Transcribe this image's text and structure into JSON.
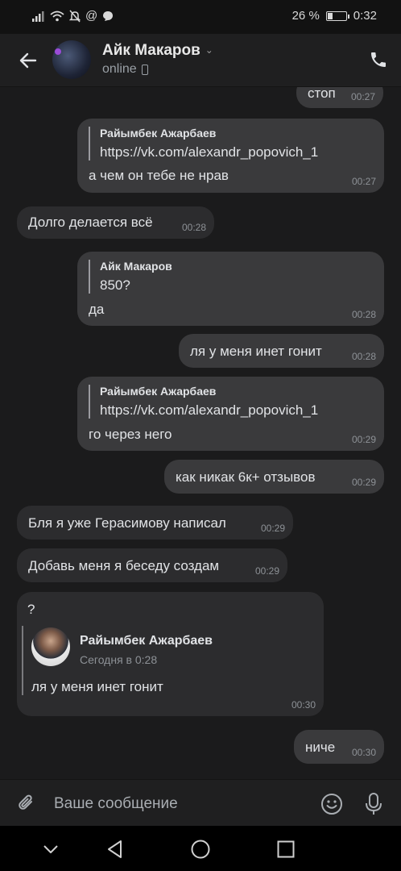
{
  "status_bar": {
    "battery_text": "26 %",
    "battery_level": 0.26,
    "time": "0:32",
    "icons": [
      "signal-icon",
      "wifi-icon",
      "mute-icon",
      "at-icon",
      "chat-notification-icon"
    ]
  },
  "header": {
    "name": "Айк Макаров",
    "status": "online",
    "icons": [
      "back-arrow-icon",
      "chevron-down-icon",
      "mobile-icon",
      "phone-icon"
    ]
  },
  "messages": [
    {
      "dir": "out",
      "text": "стоп",
      "time": "00:27"
    },
    {
      "dir": "out",
      "reply_name": "Райымбек Ажарбаев",
      "reply_text": "https://vk.com/alexandr_popovich_1",
      "text": "а чем он тебе не нрав",
      "time": "00:27"
    },
    {
      "dir": "in",
      "text": "Долго делается всё",
      "time": "00:28"
    },
    {
      "dir": "out",
      "reply_name": "Айк Макаров",
      "reply_text": "850?",
      "text": "да",
      "time": "00:28"
    },
    {
      "dir": "out",
      "text": "ля у меня инет гонит",
      "time": "00:28"
    },
    {
      "dir": "out",
      "reply_name": "Райымбек Ажарбаев",
      "reply_text": "https://vk.com/alexandr_popovich_1",
      "text": "го через него",
      "time": "00:29"
    },
    {
      "dir": "out",
      "text": "как никак 6к+ отзывов",
      "time": "00:29"
    },
    {
      "dir": "in",
      "text": "Бля я уже Герасимову написал",
      "time": "00:29"
    },
    {
      "dir": "in",
      "text": "Добавь меня я беседу создам",
      "time": "00:29"
    },
    {
      "dir": "in",
      "text": "?",
      "forward_name": "Райымбек Ажарбаев",
      "forward_date": "Сегодня в 0:28",
      "forward_text": "ля у меня инет гонит",
      "time": "00:30"
    },
    {
      "dir": "out",
      "text": "ниче",
      "time": "00:30"
    }
  ],
  "composer": {
    "placeholder": "Ваше сообщение",
    "icons": [
      "attach-icon",
      "emoji-icon",
      "microphone-icon"
    ]
  },
  "nav_bar": {
    "icons": [
      "hide-keyboard-icon",
      "back-icon",
      "home-icon",
      "recents-icon"
    ]
  },
  "colors": {
    "background": "#1b1b1c",
    "outgoing_bubble": "#3a3a3c",
    "incoming_bubble": "#2c2c2e",
    "time_text": "#8d9196"
  }
}
